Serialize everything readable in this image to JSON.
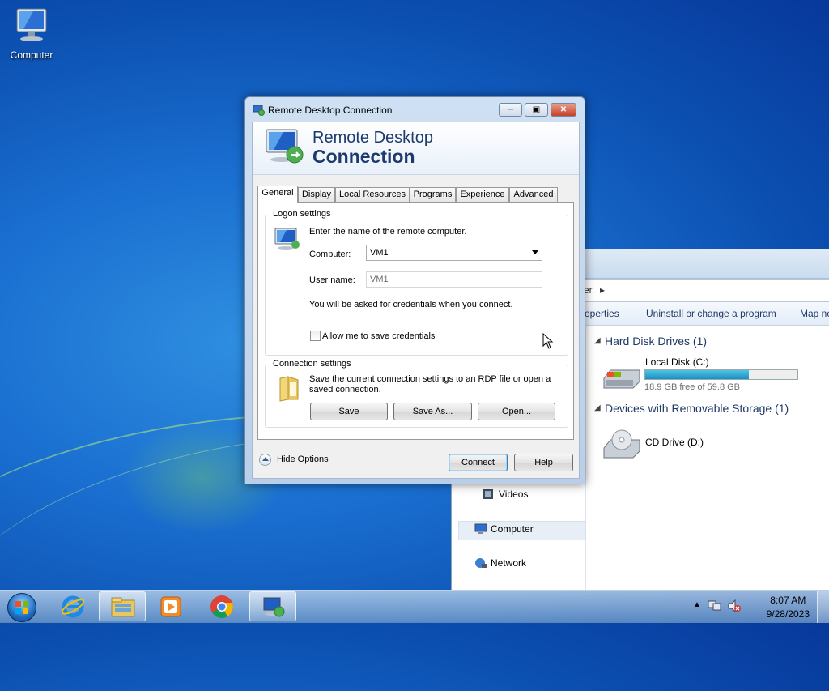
{
  "desktop": {
    "icons": [
      {
        "label": "Computer",
        "icon": "computer-icon"
      }
    ]
  },
  "explorer": {
    "address_fragment": "er",
    "toolbar": [
      "roperties",
      "Uninstall or change a program",
      "Map ne"
    ],
    "nav_items": [
      "Videos",
      "Computer",
      "Network"
    ],
    "groups": [
      {
        "title": "Hard Disk Drives (1)",
        "drives": [
          {
            "name": "Local Disk (C:)",
            "free": "18.9 GB free of 59.8 GB",
            "used_fraction": 0.68
          }
        ]
      },
      {
        "title": "Devices with Removable Storage (1)",
        "drives": [
          {
            "name": "CD Drive (D:)"
          }
        ]
      }
    ]
  },
  "rdp": {
    "window_title": "Remote Desktop Connection",
    "banner_line1": "Remote Desktop",
    "banner_line2": "Connection",
    "tabs": [
      "General",
      "Display",
      "Local Resources",
      "Programs",
      "Experience",
      "Advanced"
    ],
    "active_tab": "General",
    "logon": {
      "legend": "Logon settings",
      "instruction": "Enter the name of the remote computer.",
      "computer_label": "Computer:",
      "computer_value": "VM1",
      "username_label": "User name:",
      "username_value": "VM1",
      "credentials_note": "You will be asked for credentials when you connect.",
      "allow_save_label": "Allow me to save credentials",
      "allow_save_checked": false
    },
    "connection": {
      "legend": "Connection settings",
      "description_line1": "Save the current connection settings to an RDP file or open a",
      "description_line2": "saved connection.",
      "save_label": "Save",
      "save_as_label": "Save As...",
      "open_label": "Open..."
    },
    "hide_options_label": "Hide Options",
    "connect_label": "Connect",
    "help_label": "Help"
  },
  "taskbar": {
    "clock_time": "8:07 AM",
    "clock_date": "9/28/2023",
    "apps": [
      "internet-explorer-icon",
      "file-explorer-icon",
      "media-player-icon",
      "chrome-icon",
      "remote-desktop-icon"
    ]
  },
  "colors": {
    "accent": "#1d3a6e",
    "progress": "#1e8fc0"
  }
}
